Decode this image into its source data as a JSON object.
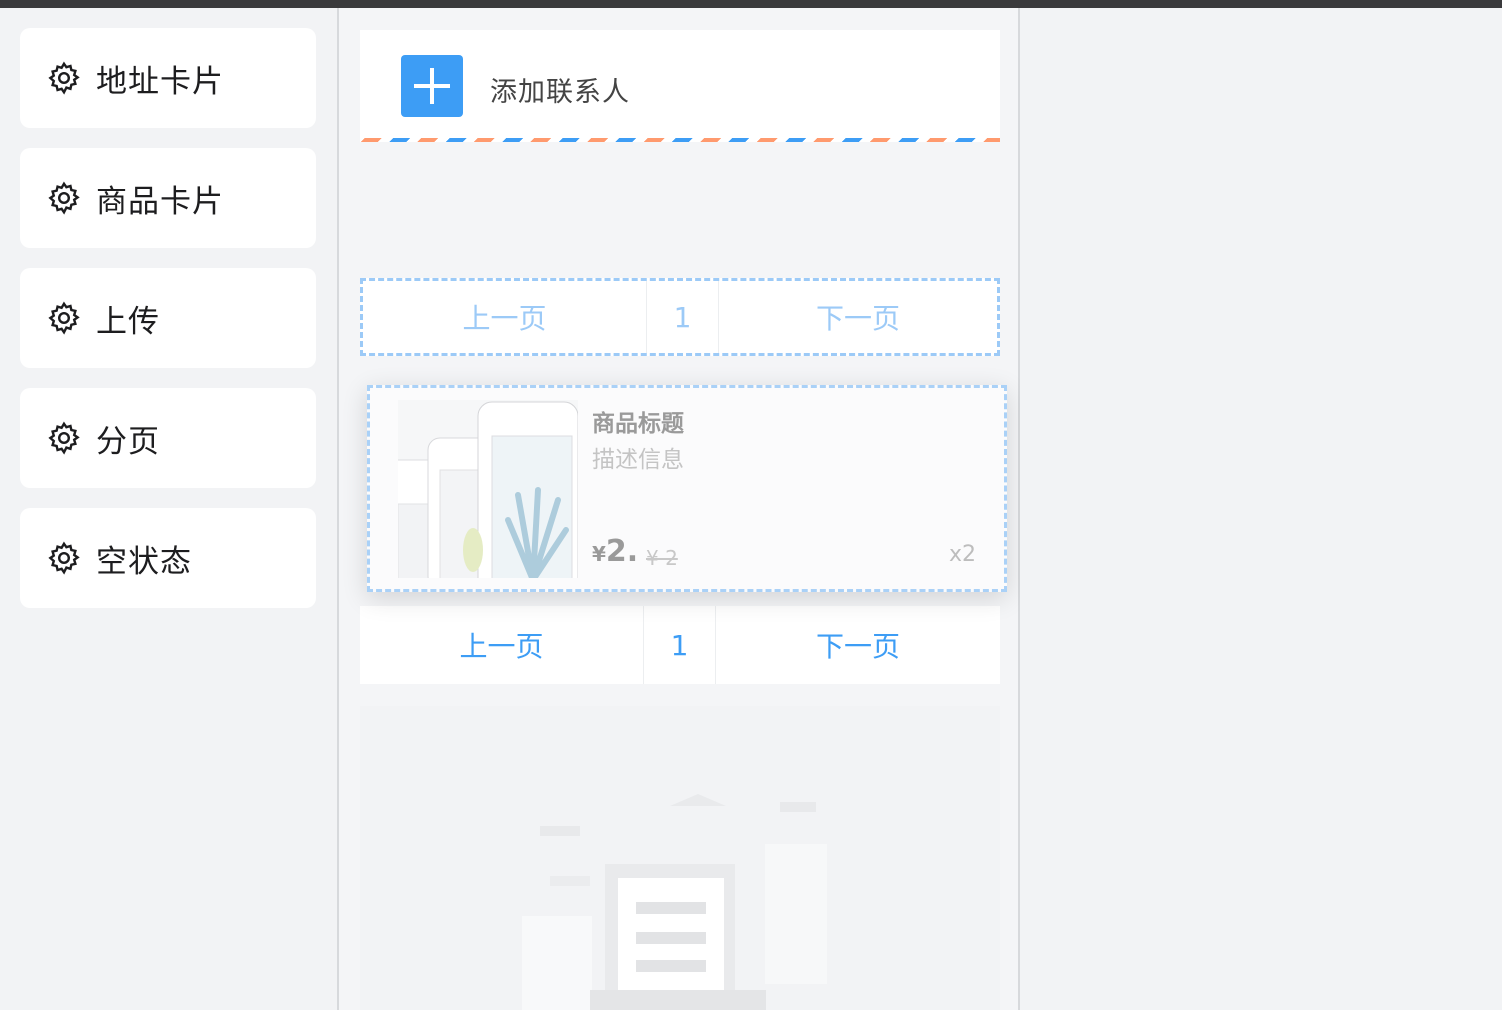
{
  "palette": {
    "items": [
      {
        "label": "地址卡片"
      },
      {
        "label": "商品卡片"
      },
      {
        "label": "上传"
      },
      {
        "label": "分页"
      },
      {
        "label": "空状态"
      }
    ]
  },
  "address_card": {
    "add_label": "添加联系人"
  },
  "pager_drop": {
    "prev": "上一页",
    "page": "1",
    "next": "下一页"
  },
  "goods_card": {
    "title": "商品标题",
    "desc": "描述信息",
    "price_symbol": "¥",
    "price": "2.",
    "origin_price": "¥ 2",
    "num": "x2"
  },
  "pager": {
    "prev": "上一页",
    "page": "1",
    "next": "下一页"
  },
  "colors": {
    "accent": "#3d9df5",
    "stripe_orange": "#ff9a6e",
    "drop_border": "#9ccaf7"
  }
}
